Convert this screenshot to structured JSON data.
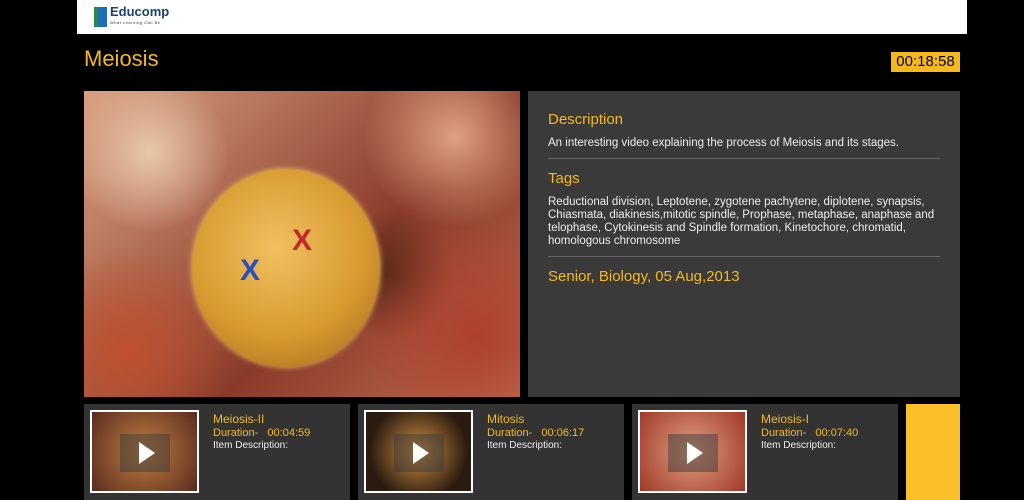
{
  "header": {
    "logo_name": "Educomp",
    "logo_tagline": "What Learning Can Be"
  },
  "video": {
    "title": "Meiosis",
    "time": "00:18:58"
  },
  "details": {
    "description_heading": "Description",
    "description": "An interesting video explaining the process of Meiosis and its stages.",
    "tags_heading": "Tags",
    "tags": "Reductional division, Leptotene, zygotene pachytene, diplotene, synapsis, Chiasmata, diakinesis,mitotic spindle, Prophase, metaphase, anaphase and telophase, Cytokinesis and Spindle formation, Kinetochore, chromatid, homologous chromosome",
    "meta": "Senior, Biology, 05 Aug,2013"
  },
  "related": [
    {
      "title": "Meiosis-II",
      "duration_label": "Duration-",
      "duration": "00:04:59",
      "desc_label": "Item Description:"
    },
    {
      "title": "Mitosis",
      "duration_label": "Duration-",
      "duration": "00:06:17",
      "desc_label": "Item Description:"
    },
    {
      "title": "Meiosis-I",
      "duration_label": "Duration-",
      "duration": "00:07:40",
      "desc_label": "Item Description:"
    }
  ],
  "colors": {
    "accent": "#f5b91e",
    "panel": "#3a3a3a"
  }
}
